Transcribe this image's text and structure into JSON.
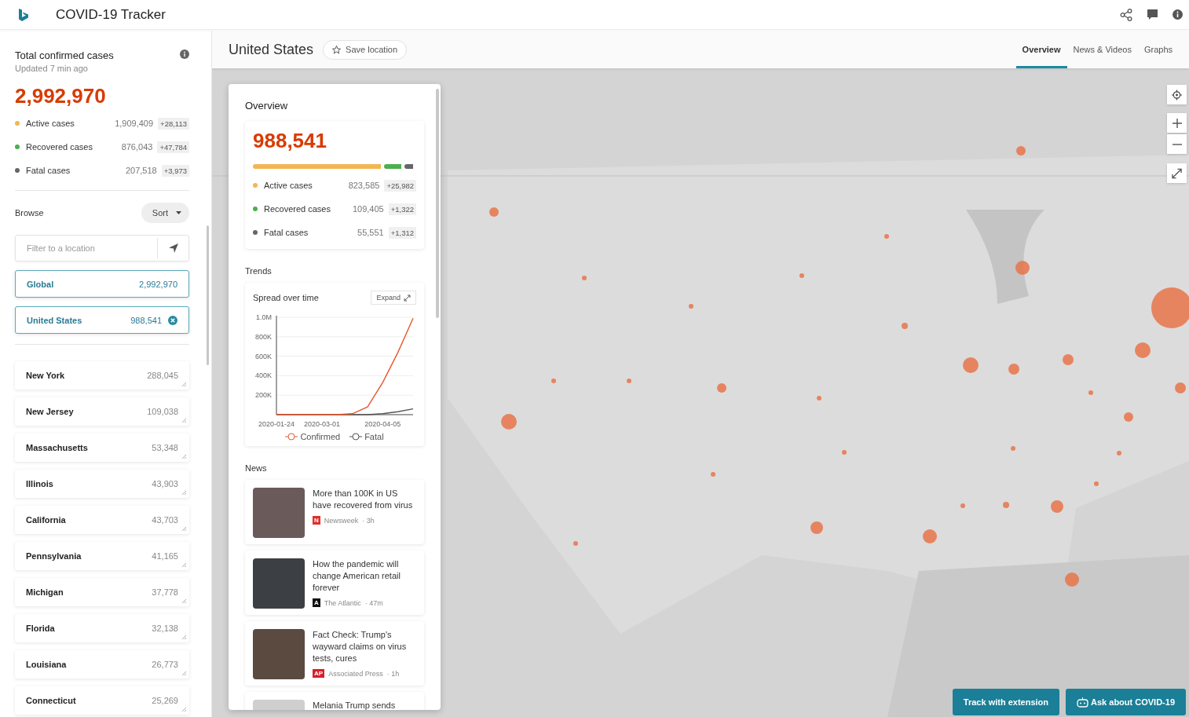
{
  "app": {
    "title": "COVID-19 Tracker"
  },
  "summary": {
    "title": "Total confirmed cases",
    "updated": "Updated 7 min ago",
    "total": "2,992,970",
    "stats": [
      {
        "label": "Active cases",
        "value": "1,909,409",
        "delta": "+28,113",
        "color": "#f2b654"
      },
      {
        "label": "Recovered cases",
        "value": "876,043",
        "delta": "+47,784",
        "color": "#4caf50"
      },
      {
        "label": "Fatal cases",
        "value": "207,518",
        "delta": "+3,973",
        "color": "#666666"
      }
    ]
  },
  "browse": {
    "title": "Browse",
    "sort": "Sort",
    "filter_placeholder": "Filter to a location",
    "pinned": [
      {
        "name": "Global",
        "count": "2,992,970",
        "removable": false
      },
      {
        "name": "United States",
        "count": "988,541",
        "removable": true
      }
    ],
    "locations": [
      {
        "name": "New York",
        "count": "288,045"
      },
      {
        "name": "New Jersey",
        "count": "109,038"
      },
      {
        "name": "Massachusetts",
        "count": "53,348"
      },
      {
        "name": "Illinois",
        "count": "43,903"
      },
      {
        "name": "California",
        "count": "43,703"
      },
      {
        "name": "Pennsylvania",
        "count": "41,165"
      },
      {
        "name": "Michigan",
        "count": "37,778"
      },
      {
        "name": "Florida",
        "count": "32,138"
      },
      {
        "name": "Louisiana",
        "count": "26,773"
      },
      {
        "name": "Connecticut",
        "count": "25,269"
      }
    ]
  },
  "location": {
    "title": "United States",
    "save": "Save location",
    "tabs": [
      {
        "label": "Overview",
        "selected": true
      },
      {
        "label": "News & Videos",
        "selected": false
      },
      {
        "label": "Graphs",
        "selected": false
      }
    ]
  },
  "overview": {
    "title": "Overview",
    "total": "988,541",
    "stats": [
      {
        "label": "Active cases",
        "value": "823,585",
        "delta": "+25,982",
        "color": "#f2b654"
      },
      {
        "label": "Recovered cases",
        "value": "109,405",
        "delta": "+1,322",
        "color": "#4caf50"
      },
      {
        "label": "Fatal cases",
        "value": "55,551",
        "delta": "+1,312",
        "color": "#666666"
      }
    ]
  },
  "trends": {
    "title": "Trends",
    "card_title": "Spread over time",
    "expand": "Expand",
    "chart_data": {
      "type": "line",
      "categories": [
        "2020-01-24",
        null,
        null,
        "2020-03-01",
        null,
        null,
        null,
        "2020-04-05",
        null,
        null
      ],
      "grid": true,
      "series": [
        {
          "name": "Confirmed",
          "color": "#e8562a",
          "values": [
            0,
            0,
            0,
            0,
            0,
            10000,
            80000,
            330000,
            640000,
            990000
          ]
        },
        {
          "name": "Fatal",
          "color": "#555555",
          "values": [
            0,
            0,
            0,
            0,
            0,
            0,
            0,
            10000,
            30000,
            60000
          ]
        }
      ],
      "ylim": [
        0,
        1000000
      ],
      "yticks": [
        {
          "value": 200000,
          "label": "200K"
        },
        {
          "value": 400000,
          "label": "400K"
        },
        {
          "value": 600000,
          "label": "600K"
        },
        {
          "value": 800000,
          "label": "800K"
        },
        {
          "value": 1000000,
          "label": "1.0M"
        }
      ]
    }
  },
  "news": {
    "title": "News",
    "items": [
      {
        "headline": "More than 100K in US have recovered from virus",
        "logo": "N",
        "color": "#e0302a",
        "source": "Newsweek",
        "age": "· 3h"
      },
      {
        "headline": "How the pandemic will change American retail forever",
        "logo": "A",
        "color": "#111111",
        "source": "The Atlantic",
        "age": "· 47m"
      },
      {
        "headline": "Fact Check: Trump's wayward claims on virus tests, cures",
        "logo": "AP",
        "color": "#d81e2a",
        "source": "Associated Press",
        "age": "· 1h"
      },
      {
        "headline": "Melania Trump sends"
      }
    ]
  },
  "actions": [
    {
      "label": "Track with extension",
      "kind": "plain"
    },
    {
      "label": "Ask about COVID-19",
      "kind": "assistant"
    }
  ]
}
